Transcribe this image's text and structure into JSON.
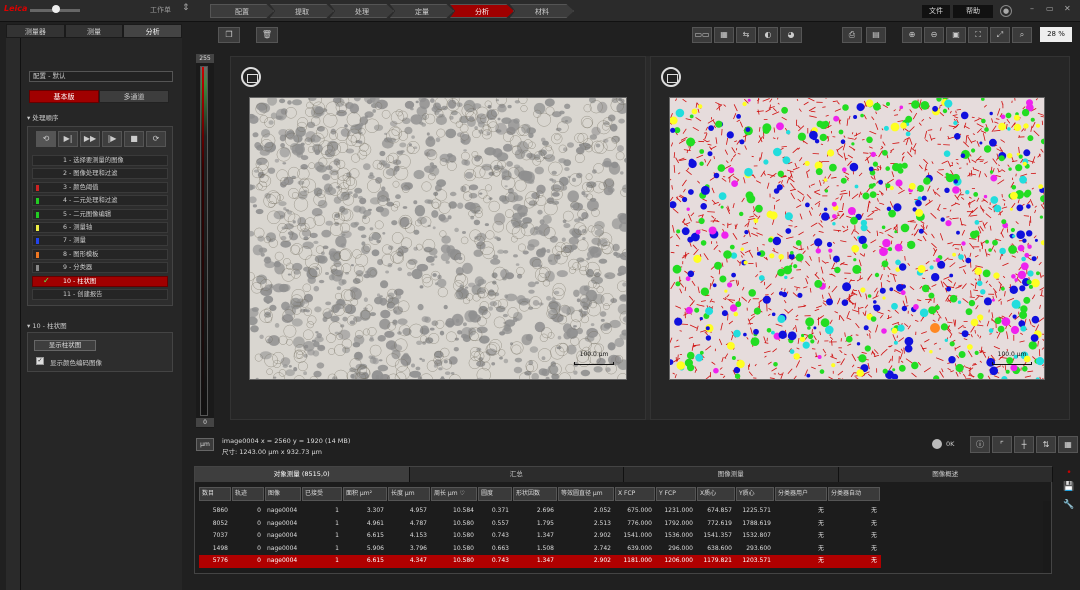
{
  "topbar": {
    "logo": "Leica",
    "workflow_label": "工作单",
    "steps": [
      {
        "label": "配置",
        "active": false
      },
      {
        "label": "提取",
        "active": false
      },
      {
        "label": "处理",
        "active": false
      },
      {
        "label": "定量",
        "active": false
      },
      {
        "label": "分析",
        "active": true
      },
      {
        "label": "材料",
        "active": false
      }
    ],
    "menu_file": "文件",
    "menu_help": "帮助",
    "win_min": "–",
    "win_max": "▭",
    "win_close": "✕"
  },
  "left_tabs": [
    "测量器",
    "测量",
    "分析"
  ],
  "config": {
    "section_label": "配置 - 默认",
    "mode_basic": "基本版",
    "mode_multi": "多通道"
  },
  "procedure": {
    "section_label": "处理顺序",
    "player_buttons": [
      "⟲",
      "▶|",
      "▶▶",
      "|▶",
      "■",
      "⟳"
    ],
    "steps": [
      {
        "label": "1 - 选择要测量的图像",
        "color": ""
      },
      {
        "label": "2 - 图像处理和过滤",
        "color": ""
      },
      {
        "label": "3 - 颜色阈值",
        "color": "#cc2222"
      },
      {
        "label": "4 - 二元处理和过滤",
        "color": "#22cc22"
      },
      {
        "label": "5 - 二元图像编辑",
        "color": "#22cc22"
      },
      {
        "label": "6 - 测量轴",
        "color": "#eeee44"
      },
      {
        "label": "7 - 测量",
        "color": "#2244ee"
      },
      {
        "label": "8 - 图形模板",
        "color": "#ee7722"
      },
      {
        "label": "9 - 分类器",
        "color": "#888888"
      },
      {
        "label": "10 - 柱状图",
        "color": "",
        "active": true
      },
      {
        "label": "11 - 创建报告",
        "color": ""
      }
    ]
  },
  "histogram": {
    "section_label": "10 - 柱状图",
    "show_button": "显示柱状图",
    "color_coded_label": "显示颜色编码图像",
    "checked": true
  },
  "zoom": {
    "value": "28 %"
  },
  "colorbar": {
    "max": "255",
    "min": "0"
  },
  "scalebar": {
    "label": "100.0 μm"
  },
  "info": {
    "unit_button": "μm",
    "line1": "image0004   x = 2560 y = 1920  (14 MB)",
    "line2": "尺寸: 1243.00 μm x 932.73 μm",
    "ok_label": "0K"
  },
  "table": {
    "tabs": [
      "对象测量 (8515,0)",
      "汇总",
      "图像测量",
      "图像概述"
    ],
    "columns": [
      "数目",
      "轨迹",
      "图像",
      "已接受",
      "面积 μm²",
      "长度 μm",
      "周长 μm ♡",
      "圆度",
      "形状因数",
      "等效圆直径 μm",
      "X FCP",
      "Y FCP",
      "X质心",
      "Y质心",
      "分类器用户",
      "分类器自动"
    ],
    "rows": [
      [
        "5860",
        "0",
        "nage0004",
        "1",
        "3.307",
        "4.957",
        "10.584",
        "0.371",
        "2.696",
        "2.052",
        "675.000",
        "1231.000",
        "674.857",
        "1225.571",
        "无",
        "无"
      ],
      [
        "8052",
        "0",
        "nage0004",
        "1",
        "4.961",
        "4.787",
        "10.580",
        "0.557",
        "1.795",
        "2.513",
        "776.000",
        "1792.000",
        "772.619",
        "1788.619",
        "无",
        "无"
      ],
      [
        "7037",
        "0",
        "nage0004",
        "1",
        "6.615",
        "4.153",
        "10.580",
        "0.743",
        "1.347",
        "2.902",
        "1541.000",
        "1536.000",
        "1541.357",
        "1532.807",
        "无",
        "无"
      ],
      [
        "1498",
        "0",
        "nage0004",
        "1",
        "5.906",
        "3.796",
        "10.580",
        "0.663",
        "1.508",
        "2.742",
        "639.000",
        "296.000",
        "638.600",
        "293.600",
        "无",
        "无"
      ],
      [
        "5776",
        "0",
        "nage0004",
        "1",
        "6.615",
        "4.347",
        "10.580",
        "0.743",
        "1.347",
        "2.902",
        "1181.000",
        "1206.000",
        "1179.821",
        "1203.571",
        "无",
        "无"
      ]
    ],
    "selected_row": 4
  },
  "colors": {
    "accent": "#a00000",
    "background": "#202020"
  }
}
